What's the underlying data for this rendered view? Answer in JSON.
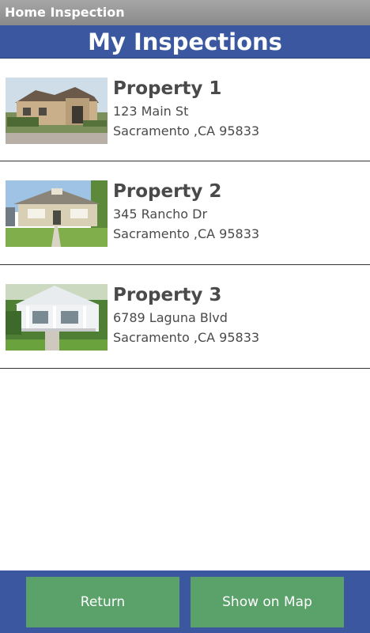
{
  "app": {
    "title": "Home Inspection"
  },
  "header": {
    "title": "My Inspections"
  },
  "properties": [
    {
      "name": "Property 1",
      "address_line1": "123 Main St",
      "address_line2": "Sacramento ,CA 95833"
    },
    {
      "name": "Property 2",
      "address_line1": "345 Rancho Dr",
      "address_line2": "Sacramento ,CA 95833"
    },
    {
      "name": "Property 3",
      "address_line1": "6789 Laguna Blvd",
      "address_line2": "Sacramento ,CA 95833"
    }
  ],
  "footer": {
    "return_label": "Return",
    "map_label": "Show on Map"
  },
  "colors": {
    "header_bg": "#3a57a0",
    "button_bg": "#5aa16a",
    "titlebar_bg": "#9a9a9a"
  }
}
